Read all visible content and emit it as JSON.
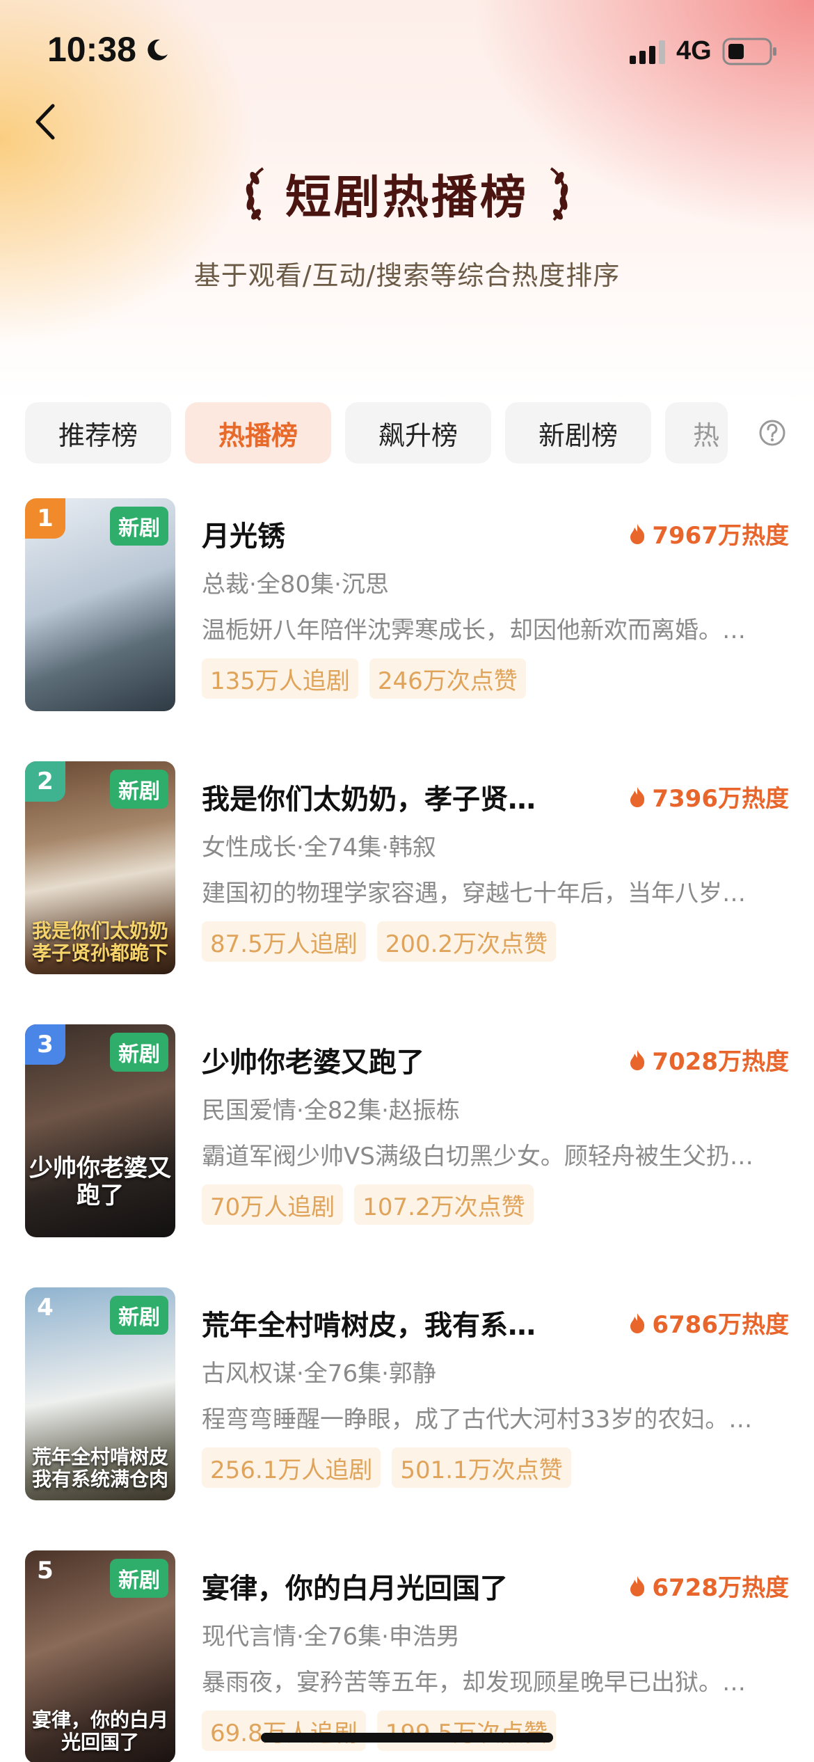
{
  "status_bar": {
    "time": "10:38",
    "network": "4G"
  },
  "header": {
    "title": "短剧热播榜",
    "subtitle": "基于观看/互动/搜索等综合热度排序"
  },
  "tabs": [
    {
      "label": "推荐榜",
      "active": false
    },
    {
      "label": "热播榜",
      "active": true
    },
    {
      "label": "飙升榜",
      "active": false
    },
    {
      "label": "新剧榜",
      "active": false
    },
    {
      "label": "热",
      "active": false
    }
  ],
  "items": [
    {
      "rank": "1",
      "badge_color": "#f08a2a",
      "tag": "新剧",
      "poster_caption": "",
      "title": "月光锈",
      "heat": "7967万热度",
      "meta": "总裁·全80集·沉思",
      "desc": "温栀妍八年陪伴沈霁寒成长，却因他新欢而离婚。…",
      "chips": [
        "135万人追剧",
        "246万次点赞"
      ]
    },
    {
      "rank": "2",
      "badge_color": "#3fb28f",
      "tag": "新剧",
      "poster_caption": "我是你们太奶奶 孝子贤孙都跪下",
      "title": "我是你们太奶奶，孝子贤…",
      "heat": "7396万热度",
      "meta": "女性成长·全74集·韩叙",
      "desc": "建国初的物理学家容遇，穿越七十年后，当年八岁…",
      "chips": [
        "87.5万人追剧",
        "200.2万次点赞"
      ]
    },
    {
      "rank": "3",
      "badge_color": "#4a86e8",
      "tag": "新剧",
      "poster_caption": "少帅你老婆又跑了",
      "title": "少帅你老婆又跑了",
      "heat": "7028万热度",
      "meta": "民国爱情·全82集·赵振栋",
      "desc": "霸道军阀少帅VS满级白切黑少女。顾轻舟被生父扔…",
      "chips": [
        "70万人追剧",
        "107.2万次点赞"
      ]
    },
    {
      "rank": "4",
      "badge_color": "rgba(0,0,0,0)",
      "tag": "新剧",
      "poster_caption": "荒年全村啃树皮 我有系统满仓肉",
      "title": "荒年全村啃树皮，我有系…",
      "heat": "6786万热度",
      "meta": "古风权谋·全76集·郭静",
      "desc": "程弯弯睡醒一睁眼，成了古代大河村33岁的农妇。…",
      "chips": [
        "256.1万人追剧",
        "501.1万次点赞"
      ]
    },
    {
      "rank": "5",
      "badge_color": "rgba(0,0,0,0)",
      "tag": "新剧",
      "poster_caption": "宴律，你的白月光回国了",
      "title": "宴律，你的白月光回国了",
      "heat": "6728万热度",
      "meta": "现代言情·全76集·申浩男",
      "desc": "暴雨夜，宴矜苦等五年，却发现顾星晚早已出狱。…",
      "chips": [
        "69.8万人追剧",
        "199.5万次点赞"
      ]
    }
  ],
  "colors": {
    "accent": "#e8652c",
    "tag_green": "#2fae6b",
    "chip_bg": "#fdf3e6",
    "chip_text": "#e0a35a"
  }
}
